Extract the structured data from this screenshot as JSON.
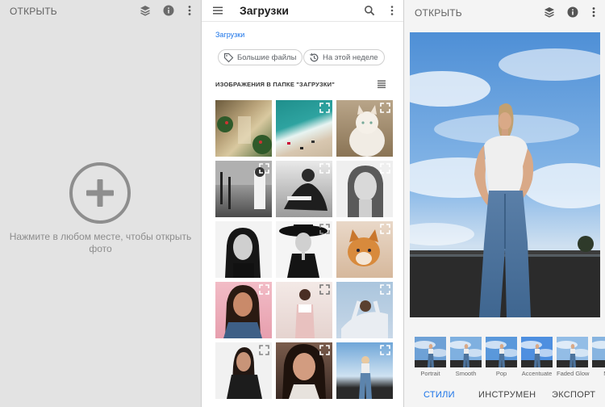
{
  "left_panel": {
    "open_label": "ОТКРЫТЬ",
    "icons": [
      "layers-icon",
      "info-icon",
      "more-vert-icon"
    ],
    "hint": "Нажмите в любом месте, чтобы открыть фото"
  },
  "picker": {
    "title": "Загрузки",
    "breadcrumb": "Загрузки",
    "chips": [
      "Большие файлы",
      "На этой неделе"
    ],
    "section_title": "ИЗОБРАЖЕНИЯ В ПАПКЕ \"ЗАГРУЗКИ\"",
    "icons": [
      "menu-icon",
      "search-icon",
      "more-vert-icon",
      "list-view-icon"
    ]
  },
  "editor": {
    "open_label": "ОТКРЫТЬ",
    "styles": [
      "Portrait",
      "Smooth",
      "Pop",
      "Accentuate",
      "Faded Glow",
      "Mo"
    ],
    "tabs": [
      "СТИЛИ",
      "ИНСТРУМЕН",
      "ЭКСПОРТ"
    ],
    "active_tab": "СТИЛИ"
  },
  "colors": {
    "accent": "#1a73e8",
    "left_bg": "#e3e3e3",
    "icon_gray": "#6b6b6b"
  }
}
